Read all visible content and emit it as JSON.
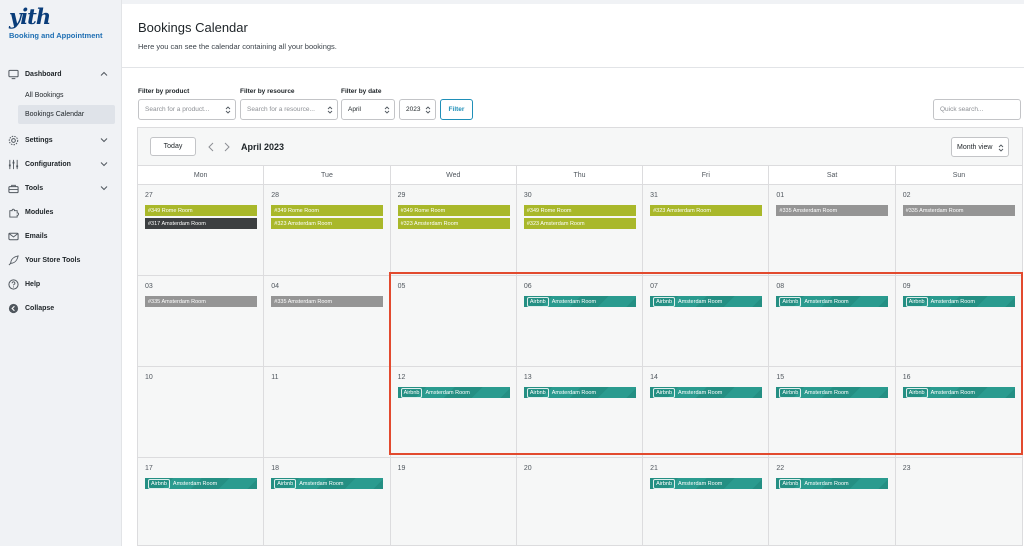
{
  "sidebar": {
    "logo": "yith",
    "brand": "Booking and Appointment",
    "items": [
      {
        "label": "Dashboard",
        "icon": "monitor-icon",
        "chevron": "up"
      },
      {
        "label": "Settings",
        "icon": "gear-icon",
        "chevron": "down"
      },
      {
        "label": "Configuration",
        "icon": "sliders-icon",
        "chevron": "down"
      },
      {
        "label": "Tools",
        "icon": "toolbox-icon",
        "chevron": "down"
      },
      {
        "label": "Modules",
        "icon": "puzzle-icon"
      },
      {
        "label": "Emails",
        "icon": "envelope-icon"
      },
      {
        "label": "Your Store Tools",
        "icon": "rocket-icon"
      },
      {
        "label": "Help",
        "icon": "help-icon"
      },
      {
        "label": "Collapse",
        "icon": "collapse-icon"
      }
    ],
    "subitems": [
      {
        "label": "All Bookings"
      },
      {
        "label": "Bookings Calendar"
      }
    ]
  },
  "header": {
    "title": "Bookings Calendar",
    "subtitle": "Here you can see the calendar containing all your bookings."
  },
  "filters": {
    "product_label": "Filter by product",
    "product_placeholder": "Search for a product...",
    "resource_label": "Filter by resource",
    "resource_placeholder": "Search for a resource...",
    "date_label": "Filter by date",
    "month_value": "April",
    "year_value": "2023",
    "filter_button": "Filter",
    "quick_search_placeholder": "Quick search..."
  },
  "calendar": {
    "today_button": "Today",
    "month_title": "April 2023",
    "view_select": "Month view",
    "day_names": [
      "Mon",
      "Tue",
      "Wed",
      "Thu",
      "Fri",
      "Sat",
      "Sun"
    ],
    "weeks": [
      [
        {
          "day": "27",
          "events": [
            {
              "text": "#349 Rome Room",
              "color": "#a9b82a"
            },
            {
              "text": "#317 Amsterdam Room",
              "color": "#3c3f41"
            }
          ]
        },
        {
          "day": "28",
          "events": [
            {
              "text": "#349 Rome Room",
              "color": "#a9b82a"
            },
            {
              "text": "#323 Amsterdam Room",
              "color": "#a9b82a"
            }
          ]
        },
        {
          "day": "29",
          "events": [
            {
              "text": "#349 Rome Room",
              "color": "#a9b82a"
            },
            {
              "text": "#323 Amsterdam Room",
              "color": "#a9b82a"
            }
          ]
        },
        {
          "day": "30",
          "events": [
            {
              "text": "#349 Rome Room",
              "color": "#a9b82a"
            },
            {
              "text": "#323 Amsterdam Room",
              "color": "#a9b82a"
            }
          ]
        },
        {
          "day": "31",
          "events": [
            {
              "text": "#323 Amsterdam Room",
              "color": "#a9b82a"
            }
          ]
        },
        {
          "day": "01",
          "events": [
            {
              "text": "#335 Amsterdam Room",
              "color": "#959595"
            }
          ]
        },
        {
          "day": "02",
          "events": [
            {
              "text": "#335 Amsterdam Room",
              "color": "#959595"
            }
          ]
        }
      ],
      [
        {
          "day": "03",
          "events": [
            {
              "text": "#335 Amsterdam Room",
              "color": "#959595"
            }
          ]
        },
        {
          "day": "04",
          "events": [
            {
              "text": "#335 Amsterdam Room",
              "color": "#959595"
            }
          ]
        },
        {
          "day": "05",
          "events": []
        },
        {
          "day": "06",
          "events": [
            {
              "tag": "Airbnb",
              "text": "Amsterdam Room",
              "color": "teal"
            }
          ]
        },
        {
          "day": "07",
          "events": [
            {
              "tag": "Airbnb",
              "text": "Amsterdam Room",
              "color": "teal"
            }
          ]
        },
        {
          "day": "08",
          "events": [
            {
              "tag": "Airbnb",
              "text": "Amsterdam Room",
              "color": "teal"
            }
          ]
        },
        {
          "day": "09",
          "events": [
            {
              "tag": "Airbnb",
              "text": "Amsterdam Room",
              "color": "teal"
            }
          ]
        }
      ],
      [
        {
          "day": "10",
          "events": []
        },
        {
          "day": "11",
          "events": []
        },
        {
          "day": "12",
          "events": [
            {
              "tag": "Airbnb",
              "text": "Amsterdam Room",
              "color": "teal"
            }
          ]
        },
        {
          "day": "13",
          "events": [
            {
              "tag": "Airbnb",
              "text": "Amsterdam Room",
              "color": "teal"
            }
          ]
        },
        {
          "day": "14",
          "events": [
            {
              "tag": "Airbnb",
              "text": "Amsterdam Room",
              "color": "teal"
            }
          ]
        },
        {
          "day": "15",
          "events": [
            {
              "tag": "Airbnb",
              "text": "Amsterdam Room",
              "color": "teal"
            }
          ]
        },
        {
          "day": "16",
          "events": [
            {
              "tag": "Airbnb",
              "text": "Amsterdam Room",
              "color": "teal"
            }
          ]
        }
      ],
      [
        {
          "day": "17",
          "events": [
            {
              "tag": "Airbnb",
              "text": "Amsterdam Room",
              "color": "teal"
            }
          ]
        },
        {
          "day": "18",
          "events": [
            {
              "tag": "Airbnb",
              "text": "Amsterdam Room",
              "color": "teal"
            }
          ]
        },
        {
          "day": "19",
          "events": []
        },
        {
          "day": "20",
          "events": []
        },
        {
          "day": "21",
          "events": [
            {
              "tag": "Airbnb",
              "text": "Amsterdam Room",
              "color": "teal"
            }
          ]
        },
        {
          "day": "22",
          "events": [
            {
              "tag": "Airbnb",
              "text": "Amsterdam Room",
              "color": "teal"
            }
          ]
        },
        {
          "day": "23",
          "events": []
        }
      ]
    ]
  },
  "colors": {
    "accent": "#1f8fb8",
    "highlight": "#e24a2e",
    "teal_event": "#248f83",
    "olive_event": "#a9b82a",
    "grey_event": "#959595",
    "dark_event": "#3c3f41"
  }
}
